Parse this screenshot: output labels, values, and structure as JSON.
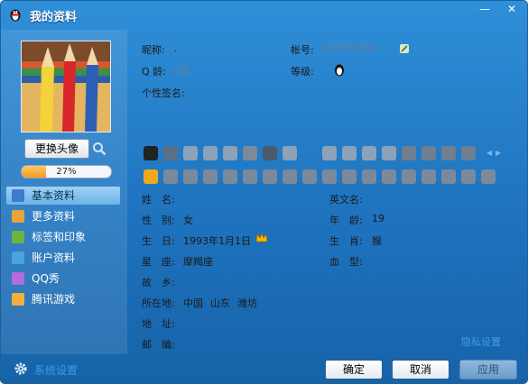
{
  "window": {
    "title": "我的资料"
  },
  "titlebar_buttons": {
    "minimize": "—",
    "close": "✕"
  },
  "avatar": {
    "change_label": "更换头像",
    "completion_text": "27%",
    "completion_fraction": 0.27
  },
  "sidebar": {
    "items": [
      {
        "label": "基本资料",
        "icon": "profile-card-icon",
        "color": "#3a7ccf",
        "active": true
      },
      {
        "label": "更多资料",
        "icon": "more-info-icon",
        "color": "#e8a53a",
        "active": false
      },
      {
        "label": "标签和印象",
        "icon": "tag-icon",
        "color": "#6db33f",
        "active": false
      },
      {
        "label": "账户资料",
        "icon": "account-icon",
        "color": "#4aa3df",
        "active": false
      },
      {
        "label": "QQ秀",
        "icon": "qq-show-icon",
        "color": "#b36be0",
        "active": false
      },
      {
        "label": "腾讯游戏",
        "icon": "tencent-games-icon",
        "color": "#f0b13c",
        "active": false
      }
    ]
  },
  "header_info": {
    "nickname_label": "昵称:",
    "nickname_value": ".",
    "account_label": "帐号:",
    "account_value": "287952502",
    "qage_label": "Q 龄:",
    "qage_value": "0年",
    "level_label": "等级:",
    "signature_label": "个性签名:"
  },
  "details": {
    "name_label": "姓　名:",
    "english_name_label": "英文名:",
    "gender_label": "性　别:",
    "gender_value": "女",
    "age_label": "年　龄:",
    "age_value": "19",
    "birthday_label": "生　日:",
    "birthday_value": "1993年1月1日",
    "zodiac_animal_label": "生　肖:",
    "zodiac_animal_value": "猴",
    "constellation_label": "星　座:",
    "constellation_value": "摩羯座",
    "blood_type_label": "血　型:",
    "hometown_label": "故　乡:",
    "location_label": "所在地:",
    "location_country": "中国",
    "location_province": "山东",
    "location_city": "潍坊",
    "address_label": "地　址:",
    "postcode_label": "邮　编:"
  },
  "privacy_link": "隐私设置",
  "footer": {
    "settings_label": "系统设置",
    "ok_label": "确定",
    "cancel_label": "取消",
    "apply_label": "应用"
  },
  "colors": {
    "window_blue": "#1f73bf",
    "link_blue": "#3f9be6"
  }
}
